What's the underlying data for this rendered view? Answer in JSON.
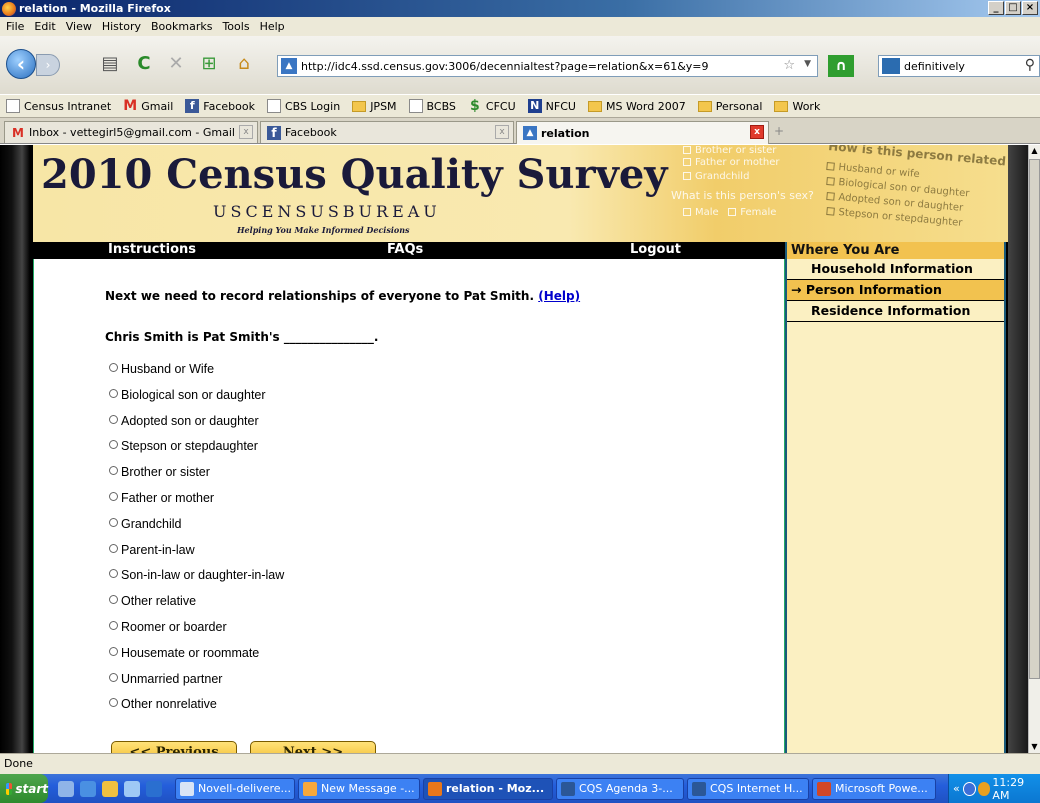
{
  "window": {
    "title": "relation - Mozilla Firefox",
    "controls": [
      "_",
      "□",
      "×"
    ]
  },
  "menu": [
    "File",
    "Edit",
    "View",
    "History",
    "Bookmarks",
    "Tools",
    "Help"
  ],
  "toolbar": {
    "url": "http://idc4.ssd.census.gov:3006/decennialtest?page=relation&x=61&y=9",
    "search_text": "definitively"
  },
  "bookmarks": [
    {
      "label": "Census Intranet",
      "icon": "page"
    },
    {
      "label": "Gmail",
      "icon": "gmail"
    },
    {
      "label": "Facebook",
      "icon": "fb"
    },
    {
      "label": "CBS Login",
      "icon": "page"
    },
    {
      "label": "JPSM",
      "icon": "folder"
    },
    {
      "label": "BCBS",
      "icon": "page"
    },
    {
      "label": "CFCU",
      "icon": "cfcu"
    },
    {
      "label": "NFCU",
      "icon": "nfcu"
    },
    {
      "label": "MS Word 2007",
      "icon": "folder"
    },
    {
      "label": "Personal",
      "icon": "folder"
    },
    {
      "label": "Work",
      "icon": "folder"
    }
  ],
  "tabs": [
    {
      "label": "Inbox - vettegirl5@gmail.com - Gmail",
      "active": false
    },
    {
      "label": "Facebook",
      "active": false
    },
    {
      "label": "relation",
      "active": true
    }
  ],
  "banner": {
    "title": "2010 Census Quality Survey",
    "bureau": "USCENSUSBUREAU",
    "tagline": "Helping You Make Informed Decisions",
    "bg_fragments": {
      "brother": "Brother or sister",
      "father": "Father or mother",
      "grandchild": "Grandchild",
      "sex_q": "What is this person's sex?",
      "male": "Male",
      "female": "Female",
      "rel_q": "How is this person related to P",
      "husband": "Husband or wife",
      "bio": "Biological son or daughter",
      "adopted": "Adopted son or daughter",
      "step": "Stepson or stepdaughter"
    }
  },
  "nav": {
    "instructions": "Instructions",
    "faqs": "FAQs",
    "logout": "Logout"
  },
  "sidebar": {
    "heading": "Where You Are",
    "items": [
      {
        "label": "Household Information",
        "current": false
      },
      {
        "label": "→ Person Information",
        "current": true
      },
      {
        "label": "Residence Information",
        "current": false
      }
    ]
  },
  "question": {
    "intro": "Next we need to record relationships of everyone to Pat Smith.",
    "help_link": "(Help)",
    "prompt": "Chris Smith is Pat Smith's _______________."
  },
  "options": [
    "Husband or Wife",
    "Biological son or daughter",
    "Adopted son or daughter",
    "Stepson or stepdaughter",
    "Brother or sister",
    "Father or mother",
    "Grandchild",
    "Parent-in-law",
    "Son-in-law or daughter-in-law",
    "Other relative",
    "Roomer or boarder",
    "Housemate or roommate",
    "Unmarried partner",
    "Other nonrelative"
  ],
  "buttons": {
    "previous": "<< Previous",
    "next": "Next >>"
  },
  "status": "Done",
  "taskbar": {
    "start": "start",
    "items": [
      {
        "label": "Novell-delivere...",
        "color": "#d9e4f5",
        "active": false
      },
      {
        "label": "New Message -...",
        "color": "#f7a83c",
        "active": false
      },
      {
        "label": "relation - Moz...",
        "color": "#e8771a",
        "active": true
      },
      {
        "label": "CQS Agenda 3-...",
        "color": "#2b5797",
        "active": false
      },
      {
        "label": "CQS Internet H...",
        "color": "#2b5797",
        "active": false
      },
      {
        "label": "Microsoft Powe...",
        "color": "#d24726",
        "active": false
      }
    ],
    "clock": "11:29 AM"
  }
}
